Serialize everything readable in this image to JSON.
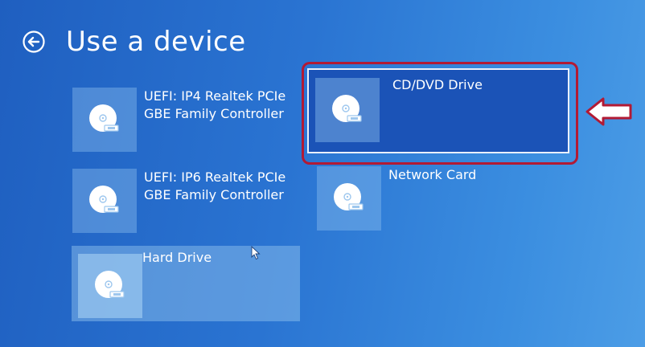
{
  "header": {
    "title": "Use a device"
  },
  "devices": [
    {
      "label_line1": "UEFI: IP4 Realtek PCIe",
      "label_line2": "GBE Family Controller",
      "icon": "disc-drive-icon",
      "state": "normal"
    },
    {
      "label_line1": "CD/DVD Drive",
      "label_line2": "",
      "icon": "disc-drive-icon",
      "state": "selected"
    },
    {
      "label_line1": "UEFI: IP6 Realtek PCIe",
      "label_line2": "GBE Family Controller",
      "icon": "disc-drive-icon",
      "state": "normal"
    },
    {
      "label_line1": "Network Card",
      "label_line2": "",
      "icon": "disc-drive-icon",
      "state": "normal"
    },
    {
      "label_line1": "Hard Drive",
      "label_line2": "",
      "icon": "disc-drive-icon",
      "state": "hovered"
    }
  ],
  "annotations": {
    "frame_color": "#b21a34",
    "arrow_color": "#b21a34",
    "arrow_direction": "left"
  },
  "colors": {
    "background": "#2a74d2",
    "selected_tile": "#1b53b7",
    "text": "#ffffff"
  }
}
